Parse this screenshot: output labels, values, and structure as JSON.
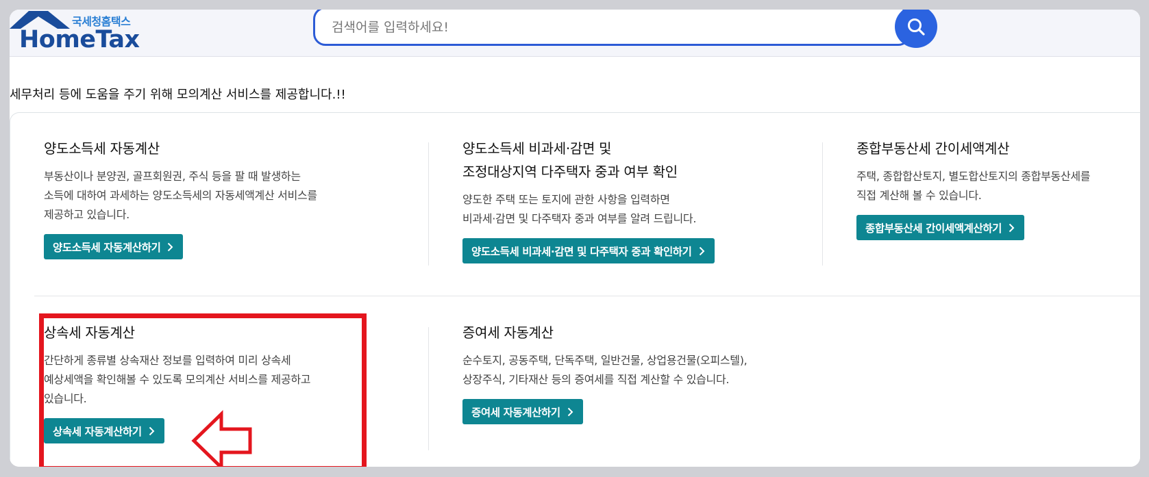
{
  "header": {
    "logo_sub": "국세청홈택스",
    "logo_main": "HomeTax",
    "search_placeholder": "검색어를 입력하세요!"
  },
  "intro_text": "세무처리 등에 도움을 주기 위해 모의계산 서비스를 제공합니다.!!",
  "cards": [
    {
      "title_lines": [
        "양도소득세 자동계산"
      ],
      "desc_lines": [
        "부동산이나 분양권, 골프회원권, 주식 등을 팔 때 발생하는",
        "소득에 대하여 과세하는 양도소득세의 자동세액계산 서비스를",
        "제공하고 있습니다."
      ],
      "button": "양도소득세 자동계산하기"
    },
    {
      "title_lines": [
        "양도소득세 비과세·감면 및",
        "조정대상지역 다주택자 중과 여부 확인"
      ],
      "desc_lines": [
        "양도한 주택 또는 토지에 관한 사항을 입력하면",
        "비과세·감면 및 다주택자 중과 여부를 알려 드립니다."
      ],
      "button": "양도소득세 비과세·감면 및 다주택자 중과 확인하기"
    },
    {
      "title_lines": [
        "종합부동산세 간이세액계산"
      ],
      "desc_lines": [
        "주택, 종합합산토지, 별도합산토지의 종합부동산세를",
        "직접 계산해 볼 수 있습니다."
      ],
      "button": "종합부동산세 간이세액계산하기"
    },
    {
      "title_lines": [
        "상속세 자동계산"
      ],
      "desc_lines": [
        "간단하게 종류별 상속재산 정보를 입력하여 미리 상속세",
        "예상세액을 확인해볼 수 있도록 모의계산 서비스를 제공하고",
        "있습니다."
      ],
      "button": "상속세 자동계산하기"
    },
    {
      "title_lines": [
        "증여세 자동계산"
      ],
      "desc_lines": [
        "순수토지, 공동주택, 단독주택, 일반건물, 상업용건물(오피스텔),",
        "상장주식, 기타재산 등의 증여세를 직접 계산할 수 있습니다."
      ],
      "button": "증여세 자동계산하기"
    }
  ],
  "colors": {
    "button_bg": "#0e8692",
    "search_accent": "#2c5bd6",
    "highlight": "#e4161e",
    "logo_blue": "#1a4c9b"
  }
}
